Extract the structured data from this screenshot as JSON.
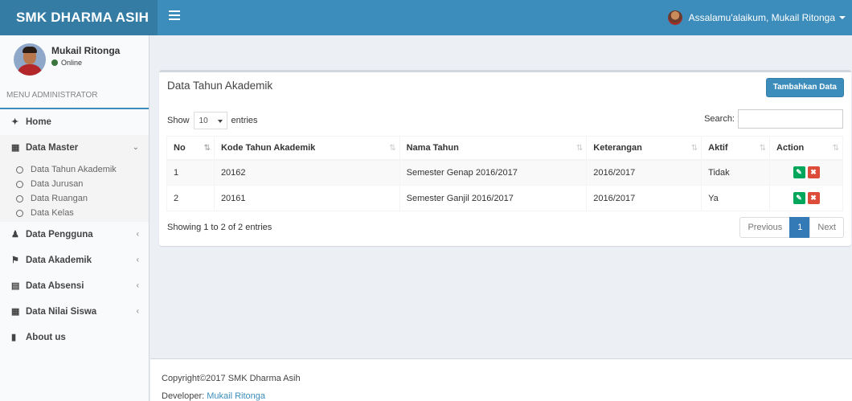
{
  "header": {
    "logo": "SMK DHARMA ASIH",
    "greeting": "Assalamu'alaikum, Mukail Ritonga"
  },
  "sidebar": {
    "user_name": "Mukail Ritonga",
    "status": "Online",
    "menu_header": "MENU ADMINISTRATOR",
    "items": {
      "home": "Home",
      "data_master": "Data Master",
      "data_pengguna": "Data Pengguna",
      "data_akademik": "Data Akademik",
      "data_absensi": "Data Absensi",
      "data_nilai_siswa": "Data Nilai Siswa",
      "about_us": "About us"
    },
    "submenu": [
      "Data Tahun Akademik",
      "Data Jurusan",
      "Data Ruangan",
      "Data Kelas"
    ]
  },
  "box": {
    "title": "Data Tahun Akademik",
    "add_button": "Tambahkan Data",
    "show_label": "Show",
    "entries_value": "10",
    "entries_label": "entries",
    "search_label": "Search:",
    "search_value": "",
    "columns": [
      "No",
      "Kode Tahun Akademik",
      "Nama Tahun",
      "Keterangan",
      "Aktif",
      "Action"
    ],
    "rows": [
      {
        "no": "1",
        "kode": "20162",
        "nama": "Semester Genap 2016/2017",
        "keterangan": "2016/2017",
        "aktif": "Tidak"
      },
      {
        "no": "2",
        "kode": "20161",
        "nama": "Semester Ganjil 2016/2017",
        "keterangan": "2016/2017",
        "aktif": "Ya"
      }
    ],
    "info": "Showing 1 to 2 of 2 entries",
    "pagination": {
      "previous": "Previous",
      "current": "1",
      "next": "Next"
    }
  },
  "footer": {
    "copyright": "Copyright©2017 SMK Dharma Asih",
    "developer_label": "Developer: ",
    "developer_name": "Mukail Ritonga"
  },
  "colors": {
    "primary": "#3c8dbc",
    "logo_bg": "#357ca5",
    "edit": "#00a65a",
    "delete": "#dd4b39",
    "online": "#3c763d"
  }
}
